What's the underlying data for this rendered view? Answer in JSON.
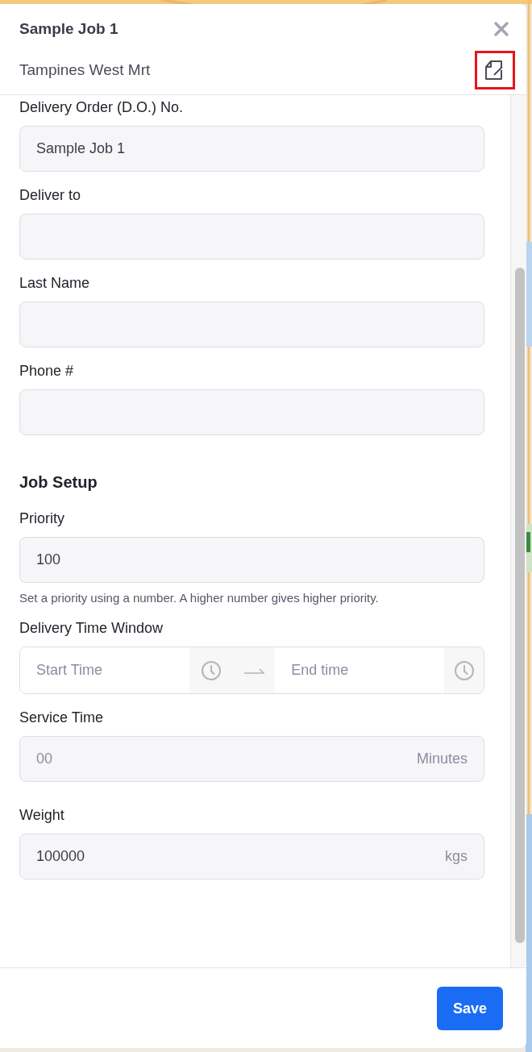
{
  "header": {
    "title": "Sample Job 1",
    "subtitle": "Tampines West Mrt",
    "edit_highlighted": true
  },
  "sections": [
    {
      "fields": [
        {
          "kind": "text",
          "label": "Delivery Order (D.O.) No.",
          "value": "Sample Job 1"
        },
        {
          "kind": "text",
          "label": "Deliver to"
        },
        {
          "kind": "text",
          "label": "Last Name"
        },
        {
          "kind": "text",
          "label": "Phone #"
        }
      ]
    },
    {
      "heading": "Job Setup",
      "fields": [
        {
          "kind": "text",
          "label": "Priority",
          "value": "100",
          "help": "Set a priority using a number. A higher number gives higher priority."
        },
        {
          "kind": "range",
          "label": "Delivery Time Window",
          "start_placeholder": "Start Time",
          "end_placeholder": "End time"
        },
        {
          "kind": "text",
          "label": "Service Time",
          "placeholder": "00",
          "suffix": "Minutes"
        },
        {
          "kind": "text",
          "label": "Weight",
          "value": "100000",
          "suffix": "kgs"
        }
      ]
    }
  ],
  "footer": {
    "save": "Save"
  }
}
